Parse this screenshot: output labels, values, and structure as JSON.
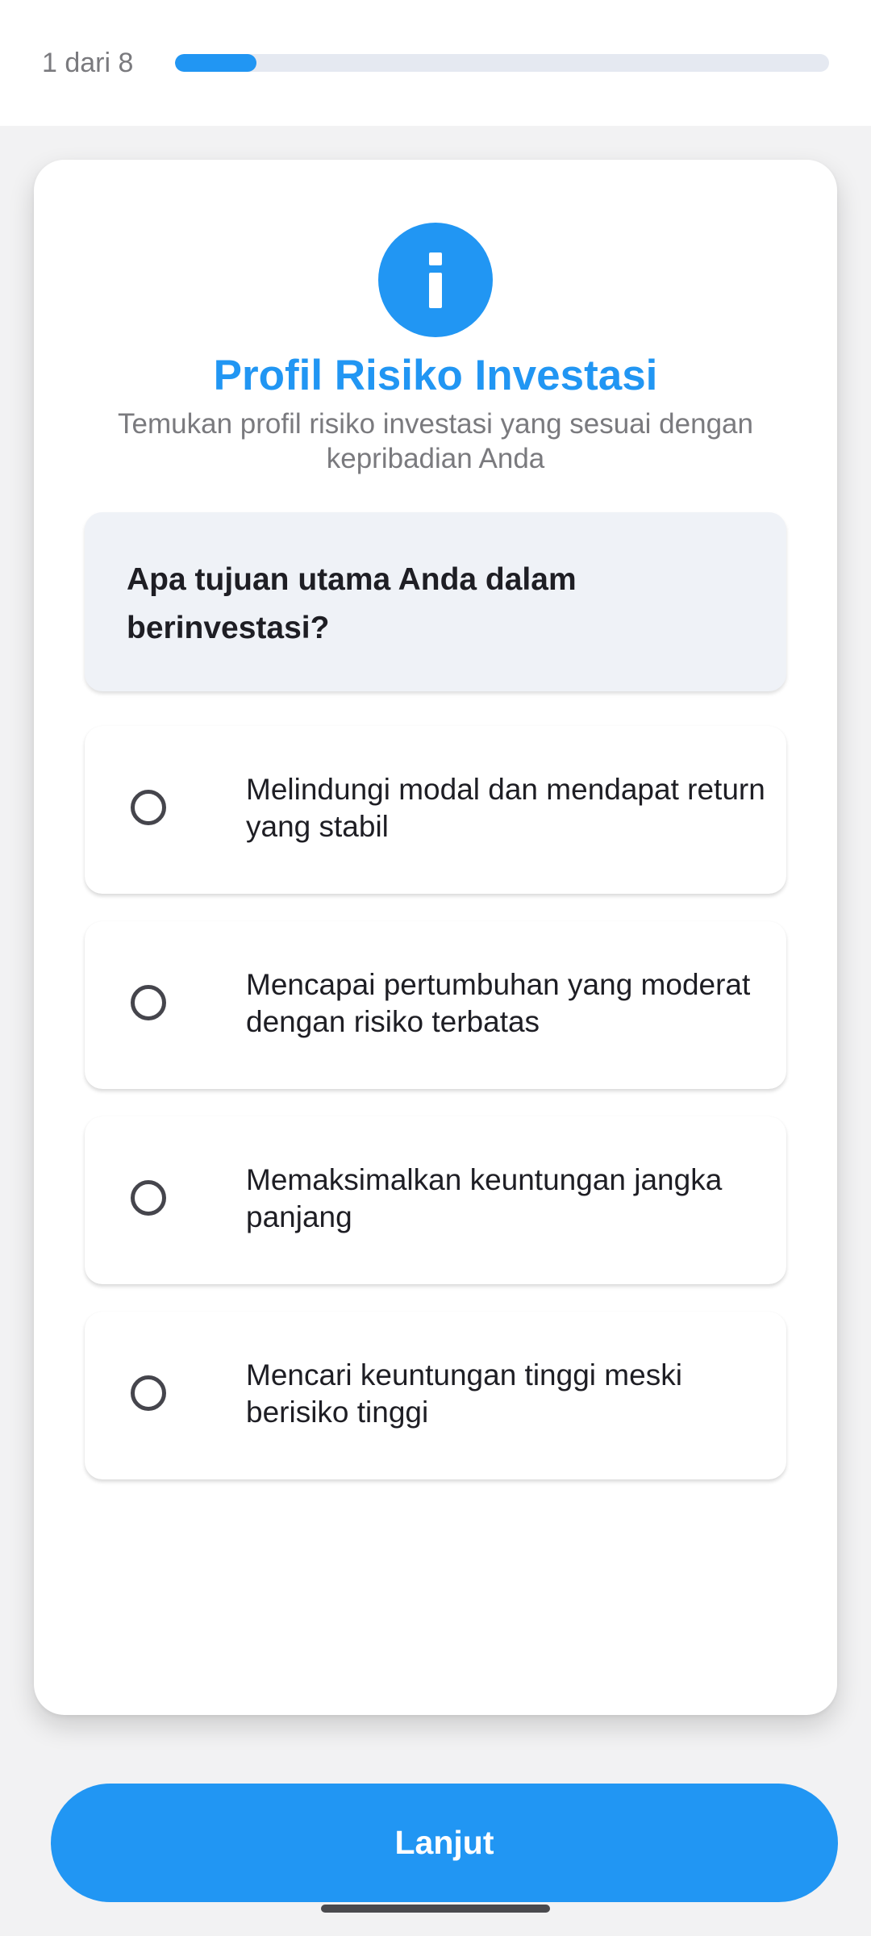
{
  "progress": {
    "label": "1 dari 8",
    "current": 1,
    "total": 8,
    "fraction": 0.125
  },
  "header": {
    "icon": "info-icon",
    "title": "Profil Risiko Investasi",
    "subtitle": "Temukan profil risiko investasi yang sesuai dengan kepribadian Anda"
  },
  "question": {
    "text": "Apa tujuan utama Anda dalam berinvestasi?"
  },
  "options": [
    {
      "label": "Melindungi modal dan mendapat return yang stabil",
      "selected": false
    },
    {
      "label": "Mencapai pertumbuhan yang moderat dengan risiko terbatas",
      "selected": false
    },
    {
      "label": "Memaksimalkan keuntungan jangka panjang",
      "selected": false
    },
    {
      "label": "Mencari keuntungan tinggi meski berisiko tinggi",
      "selected": false
    }
  ],
  "footer": {
    "next_label": "Lanjut"
  },
  "colors": {
    "accent": "#2196f3",
    "track": "#e5e9f1",
    "question_bg": "#eff2f7",
    "text_primary": "#1e1e24",
    "text_secondary": "#7a7a7e"
  }
}
